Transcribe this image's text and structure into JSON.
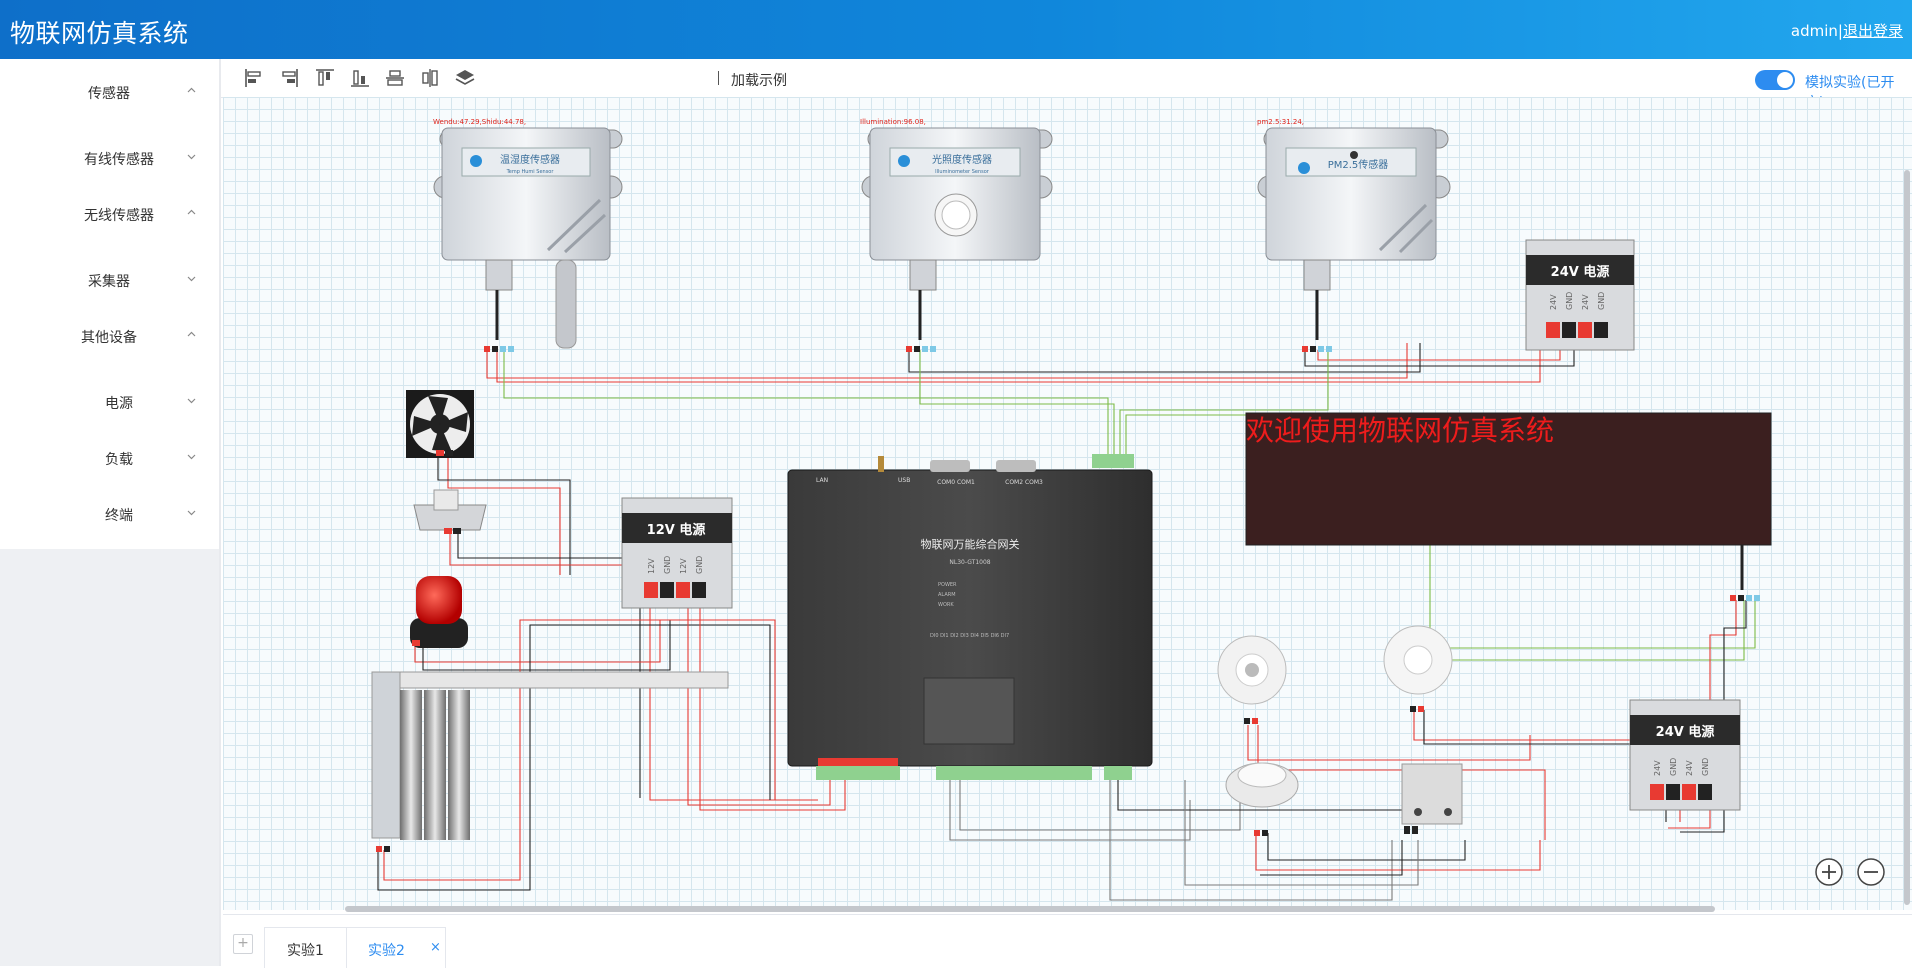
{
  "header": {
    "title": "物联网仿真系统",
    "user": "admin",
    "separator": "|",
    "logout": "退出登录"
  },
  "sidebar": {
    "items": [
      {
        "label": "传感器",
        "chevron": "up"
      },
      {
        "label": "有线传感器",
        "chevron": "down"
      },
      {
        "label": "无线传感器",
        "chevron": "up"
      },
      {
        "label": "采集器",
        "chevron": "down"
      },
      {
        "label": "其他设备",
        "chevron": "up"
      },
      {
        "label": "电源",
        "chevron": "down"
      },
      {
        "label": "负载",
        "chevron": "down"
      },
      {
        "label": "终端",
        "chevron": "down"
      }
    ]
  },
  "toolbar": {
    "icons": [
      "align-left-icon",
      "align-right-icon",
      "align-top-icon",
      "align-bottom-icon",
      "align-center-horizontal-icon",
      "align-center-vertical-icon",
      "layers-icon"
    ],
    "load_example": "加载示例",
    "simulation_label": "模拟实验(已开启)",
    "simulation_on": true
  },
  "canvas": {
    "readouts": {
      "temp_humidity": "Wendu:47.29,Shidu:44.78,",
      "illumination": "Illumination:96.08,",
      "pm25": "pm2.5:31.24,"
    },
    "sensor_names": {
      "temp_humidity": "温湿度传感器",
      "temp_humidity_en": "Temp Humi Sensor",
      "illumination": "光照度传感器",
      "illumination_en": "Illuminometer Sensor",
      "pm25": "PM2.5传感器"
    },
    "led_text": "欢迎使用物联网仿真系统",
    "gateway": {
      "title": "物联网万能综合网关",
      "model": "NL30-GT1008",
      "com_left": "COM0 COM1",
      "com_right": "COM2 COM3",
      "lan": "LAN",
      "usb": "USB",
      "indicators": [
        "POWER",
        "ALARM",
        "WORK"
      ],
      "pins_top": "DI0 DI1 DI2 DI3 DI4 DI5 DI6 DI7"
    },
    "power_supplies": {
      "p24": "24V 电源",
      "p12": "12V 电源",
      "terminals_24": [
        "24V",
        "GND",
        "24V",
        "GND"
      ],
      "terminals_12": [
        "12V",
        "GND",
        "12V",
        "GND"
      ]
    }
  },
  "tabs": [
    {
      "label": "实验1",
      "active": false
    },
    {
      "label": "实验2",
      "active": true,
      "close": "×"
    }
  ],
  "colors": {
    "accent": "#2d8cf0",
    "header_start": "#0e6fc9",
    "header_end": "#22a7ee",
    "wire_red": "#e83a32",
    "wire_black": "#222222",
    "wire_green": "#7cbb47",
    "wire_gray": "#7a7a7a",
    "led_bg": "#3b1f1f",
    "led_text": "#ee1c1c"
  }
}
